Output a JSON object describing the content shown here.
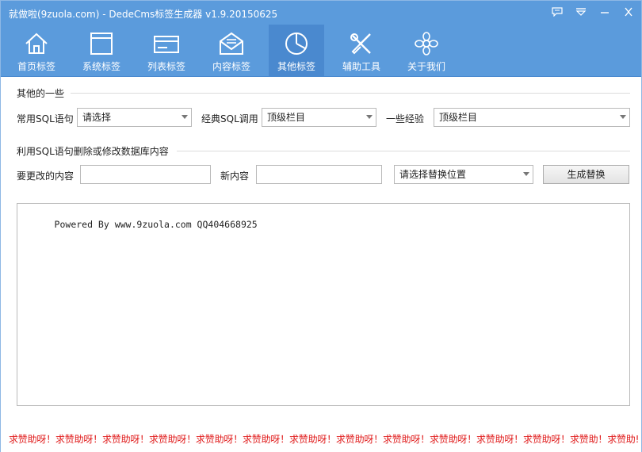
{
  "window": {
    "title": "就做啦(9zuola.com) - DedeCms标签生成器 v1.9.20150625"
  },
  "window_controls": [
    {
      "name": "message-icon"
    },
    {
      "name": "menu-dropdown-icon"
    },
    {
      "name": "minimize-icon"
    },
    {
      "name": "close-icon"
    }
  ],
  "tabs": [
    {
      "label": "首页标签",
      "icon": "home-icon"
    },
    {
      "label": "系统标签",
      "icon": "window-icon"
    },
    {
      "label": "列表标签",
      "icon": "card-icon"
    },
    {
      "label": "内容标签",
      "icon": "envelope-icon"
    },
    {
      "label": "其他标签",
      "icon": "pie-chart-icon",
      "active": true
    },
    {
      "label": "辅助工具",
      "icon": "tools-icon"
    },
    {
      "label": "关于我们",
      "icon": "flower-icon"
    }
  ],
  "section1": {
    "title": "其他的一些",
    "sql_label": "常用SQL语句",
    "sql_value": "请选择",
    "classic_label": "经典SQL调用",
    "classic_value": "顶级栏目",
    "exp_label": "一些经验",
    "exp_value": "顶级栏目"
  },
  "section2": {
    "title": "利用SQL语句删除或修改数据库内容",
    "change_label": "要更改的内容",
    "change_value": "",
    "new_label": "新内容",
    "new_value": "",
    "position_value": "请选择替换位置",
    "generate_button": "生成替换"
  },
  "output": {
    "text": "Powered By www.9zuola.com QQ404668925"
  },
  "footer": {
    "text": "求赞助呀！求赞助呀！求赞助呀！求赞助呀！求赞助呀！求赞助呀！求赞助呀！求赞助呀！求赞助呀！求赞助呀！求赞助呀！求赞助呀！求赞助！求赞助!"
  },
  "colors": {
    "titlebar": "#5b9bdc",
    "active_tab": "#4a89cf",
    "footer_text": "#e01b1b"
  }
}
